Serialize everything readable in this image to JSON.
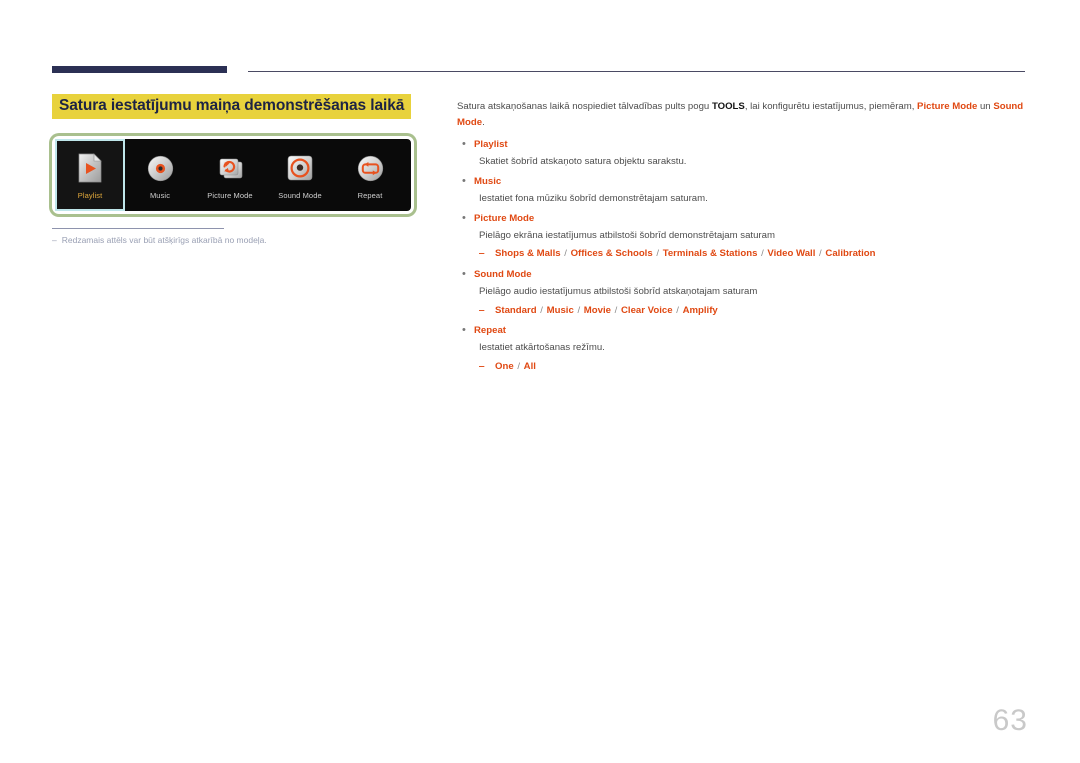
{
  "page": {
    "number": "63"
  },
  "left": {
    "section_title": "Satura iestatījumu maiņa demonstrēšanas laikā",
    "screen_menu": [
      {
        "label": "Playlist",
        "icon": "playlist-file-play-icon",
        "selected": true
      },
      {
        "label": "Music",
        "icon": "music-disc-icon",
        "selected": false
      },
      {
        "label": "Picture Mode",
        "icon": "picture-mode-refresh-icon",
        "selected": false
      },
      {
        "label": "Sound Mode",
        "icon": "sound-mode-speaker-icon",
        "selected": false
      },
      {
        "label": "Repeat",
        "icon": "repeat-loop-icon",
        "selected": false
      }
    ],
    "caption_dash": "‒",
    "caption_note": "Redzamais attēls var būt atšķirīgs atkarībā no modeļa."
  },
  "right": {
    "intro": {
      "part1": "Satura atskaņošanas laikā nospiediet tālvadības pults pogu ",
      "tools": "TOOLS",
      "part2": ", lai konfigurētu iestatījumus, piemēram, ",
      "picture_mode": "Picture Mode",
      "part3": " un ",
      "sound_mode": "Sound Mode",
      "part4": "."
    },
    "bullet_char": "•",
    "sub_dash": "‒",
    "items": [
      {
        "title": "Playlist",
        "desc": "Skatiet šobrīd atskaņoto satura objektu sarakstu.",
        "options": []
      },
      {
        "title": "Music",
        "desc": "Iestatiet fona mūziku šobrīd demonstrētajam saturam.",
        "options": []
      },
      {
        "title": "Picture Mode",
        "desc": "Pielāgo ekrāna iestatījumus atbilstoši šobrīd demonstrētajam saturam",
        "options": [
          "Shops & Malls",
          "Offices & Schools",
          "Terminals & Stations",
          "Video Wall",
          "Calibration"
        ]
      },
      {
        "title": "Sound Mode",
        "desc": "Pielāgo audio iestatījumus atbilstoši šobrīd atskaņotajam saturam",
        "options": [
          "Standard",
          "Music",
          "Movie",
          "Clear Voice",
          "Amplify"
        ]
      },
      {
        "title": "Repeat",
        "desc": "Iestatiet atkārtošanas režīmu.",
        "options": [
          "One",
          "All"
        ]
      }
    ]
  },
  "colors": {
    "accent_orange": "#e04913",
    "highlight_yellow": "#e8d23c",
    "navy": "#2b3054",
    "frame_green": "#a9c08e",
    "selection_cyan": "#bfe6ea"
  }
}
